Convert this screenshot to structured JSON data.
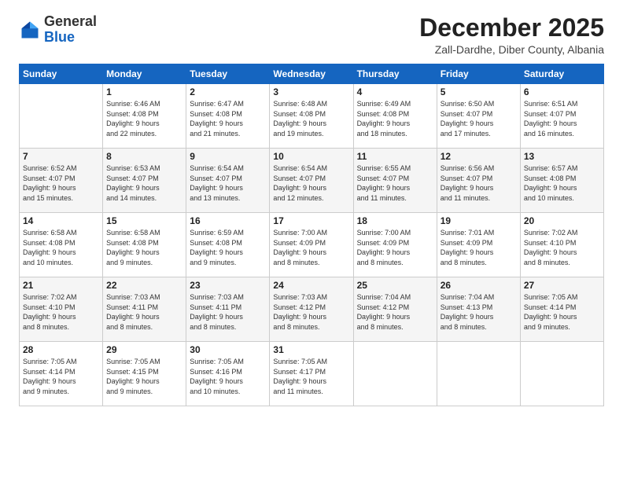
{
  "logo": {
    "general": "General",
    "blue": "Blue"
  },
  "title": "December 2025",
  "subtitle": "Zall-Dardhe, Diber County, Albania",
  "days_header": [
    "Sunday",
    "Monday",
    "Tuesday",
    "Wednesday",
    "Thursday",
    "Friday",
    "Saturday"
  ],
  "weeks": [
    [
      {
        "day": "",
        "info": ""
      },
      {
        "day": "1",
        "info": "Sunrise: 6:46 AM\nSunset: 4:08 PM\nDaylight: 9 hours\nand 22 minutes."
      },
      {
        "day": "2",
        "info": "Sunrise: 6:47 AM\nSunset: 4:08 PM\nDaylight: 9 hours\nand 21 minutes."
      },
      {
        "day": "3",
        "info": "Sunrise: 6:48 AM\nSunset: 4:08 PM\nDaylight: 9 hours\nand 19 minutes."
      },
      {
        "day": "4",
        "info": "Sunrise: 6:49 AM\nSunset: 4:08 PM\nDaylight: 9 hours\nand 18 minutes."
      },
      {
        "day": "5",
        "info": "Sunrise: 6:50 AM\nSunset: 4:07 PM\nDaylight: 9 hours\nand 17 minutes."
      },
      {
        "day": "6",
        "info": "Sunrise: 6:51 AM\nSunset: 4:07 PM\nDaylight: 9 hours\nand 16 minutes."
      }
    ],
    [
      {
        "day": "7",
        "info": "Sunrise: 6:52 AM\nSunset: 4:07 PM\nDaylight: 9 hours\nand 15 minutes."
      },
      {
        "day": "8",
        "info": "Sunrise: 6:53 AM\nSunset: 4:07 PM\nDaylight: 9 hours\nand 14 minutes."
      },
      {
        "day": "9",
        "info": "Sunrise: 6:54 AM\nSunset: 4:07 PM\nDaylight: 9 hours\nand 13 minutes."
      },
      {
        "day": "10",
        "info": "Sunrise: 6:54 AM\nSunset: 4:07 PM\nDaylight: 9 hours\nand 12 minutes."
      },
      {
        "day": "11",
        "info": "Sunrise: 6:55 AM\nSunset: 4:07 PM\nDaylight: 9 hours\nand 11 minutes."
      },
      {
        "day": "12",
        "info": "Sunrise: 6:56 AM\nSunset: 4:07 PM\nDaylight: 9 hours\nand 11 minutes."
      },
      {
        "day": "13",
        "info": "Sunrise: 6:57 AM\nSunset: 4:08 PM\nDaylight: 9 hours\nand 10 minutes."
      }
    ],
    [
      {
        "day": "14",
        "info": "Sunrise: 6:58 AM\nSunset: 4:08 PM\nDaylight: 9 hours\nand 10 minutes."
      },
      {
        "day": "15",
        "info": "Sunrise: 6:58 AM\nSunset: 4:08 PM\nDaylight: 9 hours\nand 9 minutes."
      },
      {
        "day": "16",
        "info": "Sunrise: 6:59 AM\nSunset: 4:08 PM\nDaylight: 9 hours\nand 9 minutes."
      },
      {
        "day": "17",
        "info": "Sunrise: 7:00 AM\nSunset: 4:09 PM\nDaylight: 9 hours\nand 8 minutes."
      },
      {
        "day": "18",
        "info": "Sunrise: 7:00 AM\nSunset: 4:09 PM\nDaylight: 9 hours\nand 8 minutes."
      },
      {
        "day": "19",
        "info": "Sunrise: 7:01 AM\nSunset: 4:09 PM\nDaylight: 9 hours\nand 8 minutes."
      },
      {
        "day": "20",
        "info": "Sunrise: 7:02 AM\nSunset: 4:10 PM\nDaylight: 9 hours\nand 8 minutes."
      }
    ],
    [
      {
        "day": "21",
        "info": "Sunrise: 7:02 AM\nSunset: 4:10 PM\nDaylight: 9 hours\nand 8 minutes."
      },
      {
        "day": "22",
        "info": "Sunrise: 7:03 AM\nSunset: 4:11 PM\nDaylight: 9 hours\nand 8 minutes."
      },
      {
        "day": "23",
        "info": "Sunrise: 7:03 AM\nSunset: 4:11 PM\nDaylight: 9 hours\nand 8 minutes."
      },
      {
        "day": "24",
        "info": "Sunrise: 7:03 AM\nSunset: 4:12 PM\nDaylight: 9 hours\nand 8 minutes."
      },
      {
        "day": "25",
        "info": "Sunrise: 7:04 AM\nSunset: 4:12 PM\nDaylight: 9 hours\nand 8 minutes."
      },
      {
        "day": "26",
        "info": "Sunrise: 7:04 AM\nSunset: 4:13 PM\nDaylight: 9 hours\nand 8 minutes."
      },
      {
        "day": "27",
        "info": "Sunrise: 7:05 AM\nSunset: 4:14 PM\nDaylight: 9 hours\nand 9 minutes."
      }
    ],
    [
      {
        "day": "28",
        "info": "Sunrise: 7:05 AM\nSunset: 4:14 PM\nDaylight: 9 hours\nand 9 minutes."
      },
      {
        "day": "29",
        "info": "Sunrise: 7:05 AM\nSunset: 4:15 PM\nDaylight: 9 hours\nand 9 minutes."
      },
      {
        "day": "30",
        "info": "Sunrise: 7:05 AM\nSunset: 4:16 PM\nDaylight: 9 hours\nand 10 minutes."
      },
      {
        "day": "31",
        "info": "Sunrise: 7:05 AM\nSunset: 4:17 PM\nDaylight: 9 hours\nand 11 minutes."
      },
      {
        "day": "",
        "info": ""
      },
      {
        "day": "",
        "info": ""
      },
      {
        "day": "",
        "info": ""
      }
    ]
  ]
}
